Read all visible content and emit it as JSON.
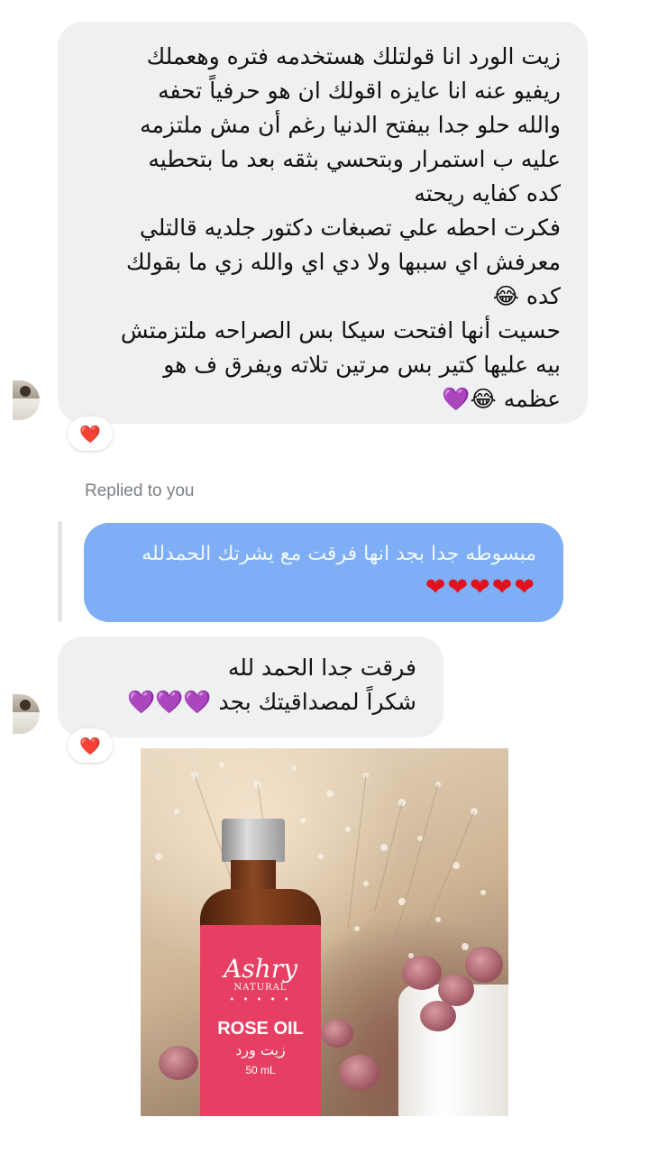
{
  "messages": [
    {
      "lines": [
        "زيت الورد انا قولتلك هستخدمه فتره وهعملك",
        "ريفيو عنه انا عايزه اقولك ان هو حرفياً تحفه",
        "والله حلو جدا بيفتح الدنيا رغم أن مش ملتزمه",
        "عليه ب استمرار وبتحسي بثقه بعد ما بتحطيه",
        "كده كفايه ريحته",
        "فكرت احطه علي تصبغات دكتور جلديه قالتلي",
        "معرفش اي سببها ولا دي اي والله زي ما بقولك",
        "كده 😂",
        "حسيت أنها افتحت سيكا بس الصراحه ملتزمتش",
        "بيه عليها كتير بس مرتين تلاته ويفرق ف هو",
        "عظمه 😂💜"
      ],
      "reaction": "❤️"
    },
    {
      "lines": [
        "فرقت جدا الحمد لله",
        "شكراً لمصداقيتك بجد 💜💜💜"
      ],
      "reaction": "❤️"
    }
  ],
  "reply": {
    "label": "Replied to you",
    "text": "مبسوطه جدا بجد انها فرقت مع يشرتك الحمدلله",
    "hearts": "❤❤❤❤❤"
  },
  "photo": {
    "brand": "Ashry",
    "brand_sub": "NATURAL",
    "dots": "• • • • •",
    "product": "ROSE OIL",
    "product_ar": "زيت ورد",
    "volume": "50 mL"
  },
  "colors": {
    "incoming_bubble": "#eef0f2",
    "outgoing_bubble": "#7eaef5",
    "heart": "#e0142a"
  }
}
